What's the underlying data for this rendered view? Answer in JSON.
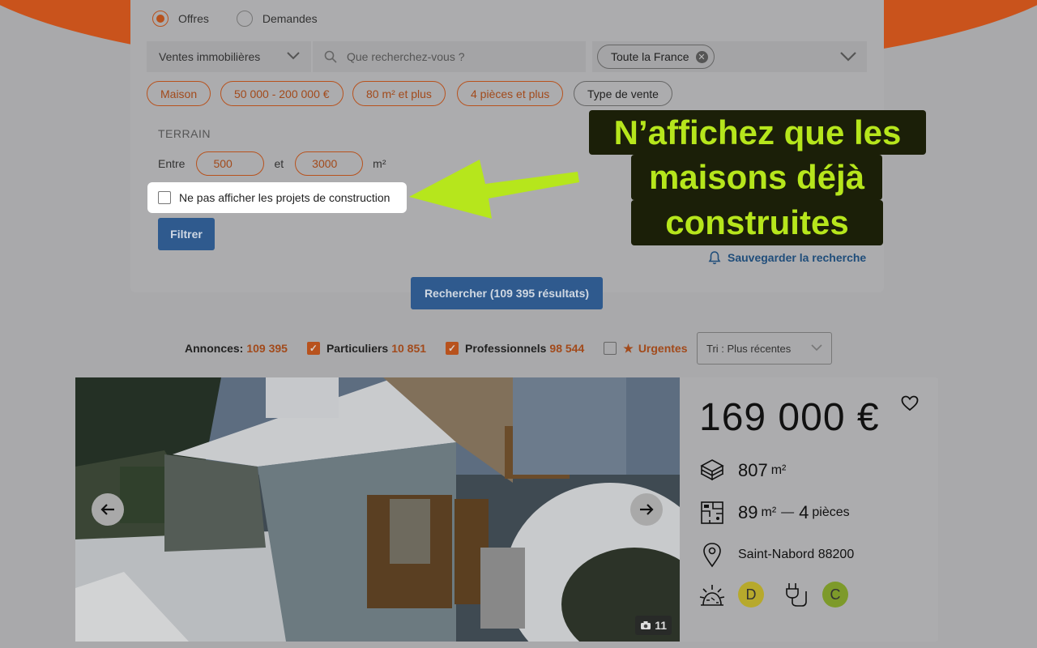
{
  "search": {
    "radio_offers": "Offres",
    "radio_requests": "Demandes",
    "category": "Ventes immobilières",
    "query_placeholder": "Que recherchez-vous ?",
    "location_chip": "Toute la France",
    "chips": [
      "Maison",
      "50 000 - 200 000 €",
      "80 m² et plus",
      "4 pièces et plus",
      "Type de vente"
    ],
    "terrain_title": "TERRAIN",
    "range_between": "Entre",
    "range_min": "500",
    "range_and": "et",
    "range_max": "3000",
    "range_unit": "m²",
    "exclude_label": "Ne pas afficher les projets de construction",
    "filter_button": "Filtrer",
    "save_search": "Sauvegarder la recherche",
    "search_button": "Rechercher (109 395 résultats)"
  },
  "callout": {
    "line1": "N’affichez que les",
    "line2": "maisons déjà",
    "line3": "construites"
  },
  "results_bar": {
    "ads_label": "Annonces:",
    "ads_count": "109 395",
    "private_label": "Particuliers",
    "private_count": "10 851",
    "pro_label": "Professionnels",
    "pro_count": "98 544",
    "urgent_label": "Urgentes",
    "sort_label": "Tri : Plus récentes"
  },
  "listing": {
    "price": "169 000 €",
    "land_area": "807",
    "land_unit": "m²",
    "living_area": "89",
    "living_unit": "m²",
    "dash": "—",
    "rooms": "4",
    "rooms_label": "pièces",
    "location": "Saint-Nabord 88200",
    "energy_class": "D",
    "ges_class": "C",
    "photo_count": "11"
  },
  "colors": {
    "accent_orange": "#b8521d",
    "button_blue": "#2f5a8e",
    "callout_text": "#b6e61c",
    "energy_D": "#b7a92c",
    "ges_C": "#7d9a2a"
  }
}
